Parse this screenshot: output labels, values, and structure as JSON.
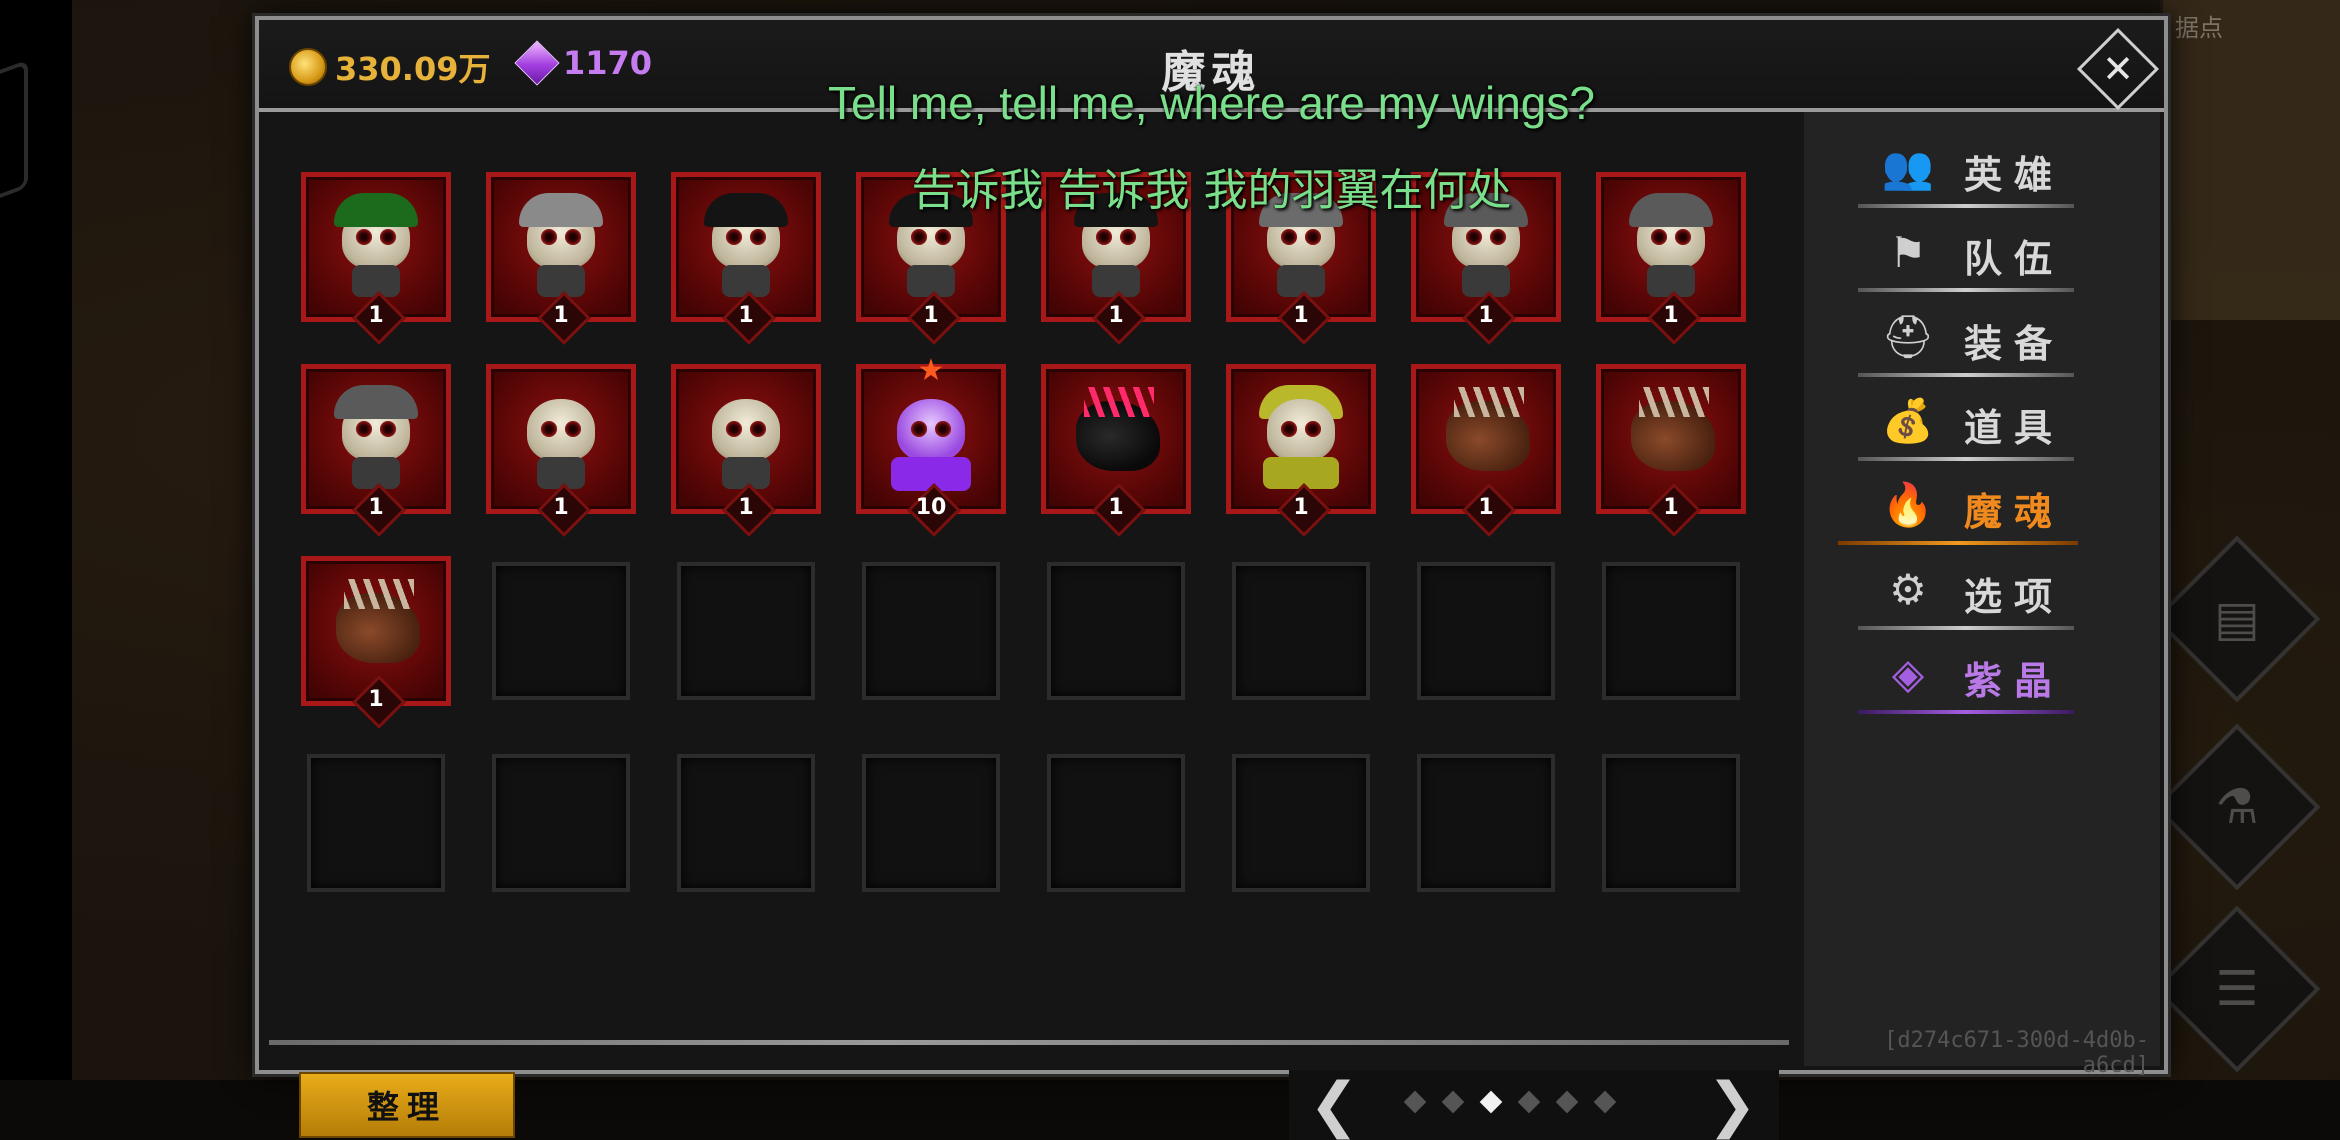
{
  "header": {
    "title": "魔魂",
    "gold": "330.09万",
    "gems": "1170",
    "close_label": "✕"
  },
  "subtitles": {
    "english": "Tell me, tell me, where are my wings?",
    "chinese": "告诉我 告诉我 我的羽翼在何处"
  },
  "map_label": "据点",
  "slots": [
    {
      "kind": "skeleton-green",
      "level": "1"
    },
    {
      "kind": "viking-yeti",
      "level": "1"
    },
    {
      "kind": "skeleton-black",
      "level": "1"
    },
    {
      "kind": "skeleton-black",
      "level": "1"
    },
    {
      "kind": "skeleton-black",
      "level": "1"
    },
    {
      "kind": "skeleton-hat",
      "level": "1"
    },
    {
      "kind": "skeleton-horned",
      "level": "1"
    },
    {
      "kind": "skeleton-horned",
      "level": "1"
    },
    {
      "kind": "skeleton-horned",
      "level": "1"
    },
    {
      "kind": "skeleton-plain",
      "level": "1"
    },
    {
      "kind": "skeleton-plain",
      "level": "1"
    },
    {
      "kind": "purple-mage",
      "level": "10",
      "starred": true
    },
    {
      "kind": "black-wolf",
      "level": "1"
    },
    {
      "kind": "golden-lich",
      "level": "1"
    },
    {
      "kind": "spiked-beast",
      "level": "1"
    },
    {
      "kind": "spiked-beast",
      "level": "1"
    },
    {
      "kind": "spiked-beast",
      "level": "1"
    }
  ],
  "empty_slot_count": 15,
  "footer": {
    "sort_label": "整理",
    "prev_label": "❮",
    "next_label": "❯",
    "page_count": 6,
    "current_page": 3
  },
  "sidebar": {
    "items": [
      {
        "label": "英雄",
        "icon": "heroes-icon"
      },
      {
        "label": "队伍",
        "icon": "flag-icon"
      },
      {
        "label": "装备",
        "icon": "helmet-icon"
      },
      {
        "label": "道具",
        "icon": "bag-icon"
      },
      {
        "label": "魔魂",
        "icon": "flame-icon",
        "active": true
      },
      {
        "label": "选项",
        "icon": "gear-icon"
      },
      {
        "label": "紫晶",
        "icon": "crystal-icon"
      }
    ]
  },
  "session_id": "[d274c671-300d-4d0b-a6cd]",
  "colors": {
    "accent_orange": "#f08a1e",
    "gold": "#e7b23a",
    "gem": "#c57cf0",
    "slot_red": "#a81818",
    "subtitle_green": "#7adf8a"
  }
}
